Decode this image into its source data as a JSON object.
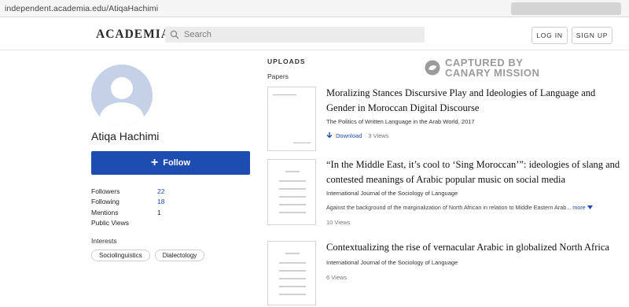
{
  "browser": {
    "url": "independent.academia.edu/AtiqaHachimi"
  },
  "header": {
    "logo": "ACADEMIA",
    "search_placeholder": "Search",
    "login_label": "LOG IN",
    "signup_label": "SIGN UP"
  },
  "profile": {
    "name": "Atiqa Hachimi",
    "follow_label": "Follow",
    "stats": [
      {
        "label": "Followers",
        "value": "22"
      },
      {
        "label": "Following",
        "value": "18"
      },
      {
        "label": "Mentions",
        "value": "1"
      },
      {
        "label": "Public Views",
        "value": ""
      }
    ],
    "interests_title": "Interests",
    "interests": [
      "Sociolinguistics",
      "Dialectology"
    ]
  },
  "uploads": {
    "title": "UPLOADS",
    "section": "Papers",
    "papers": [
      {
        "title": "Moralizing Stances Discursive Play and Ideologies of Language and Gender in Moroccan Digital Discourse",
        "journal": "The Politics of Written Language in the Arab World, 2017",
        "download_label": "Download",
        "views": "3 Views"
      },
      {
        "title": "“In the Middle East, it’s cool to ‘Sing Moroccan’”: ideologies of slang and contested meanings of Arabic popular music on social media",
        "journal": "International Journal of the Sociology of Language",
        "abstract": "Against the background of the marginalization of North African in relation to Middle Eastern Arab...",
        "more_label": "more",
        "views": "10 Views"
      },
      {
        "title": "Contextualizing the rise of vernacular Arabic in globalized North Africa",
        "journal": "International Journal of the Sociology of Language",
        "views": "6 Views"
      }
    ]
  },
  "watermark": {
    "line1": "CAPTURED BY",
    "line2": "CANARY MISSION"
  },
  "colors": {
    "brand_blue": "#1d4db0",
    "avatar_bg": "#c5d1e6"
  }
}
